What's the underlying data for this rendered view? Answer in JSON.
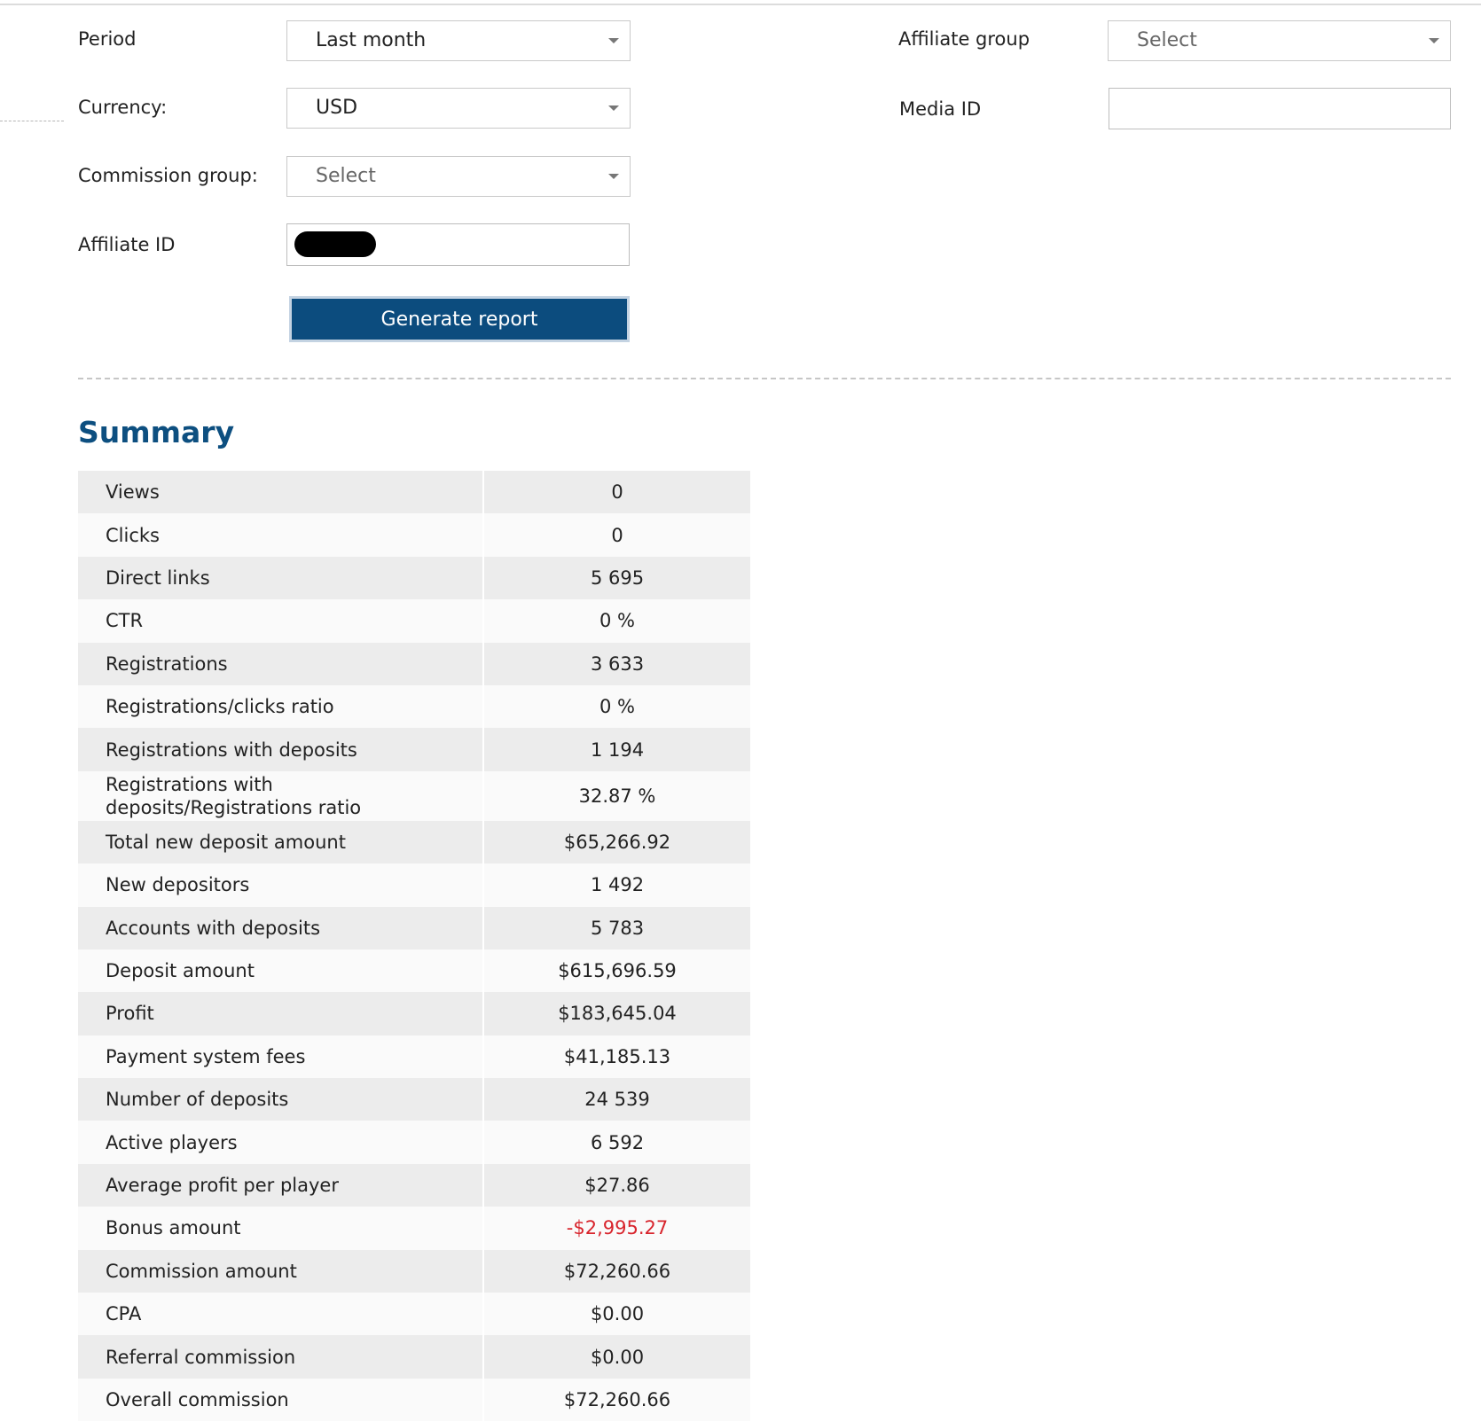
{
  "filters": {
    "period": {
      "label": "Period",
      "value": "Last month"
    },
    "currency": {
      "label": "Currency:",
      "value": "USD"
    },
    "commission_group": {
      "label": "Commission group:",
      "placeholder": "Select"
    },
    "affiliate_id": {
      "label": "Affiliate ID"
    },
    "affiliate_group": {
      "label": "Affiliate group",
      "placeholder": "Select"
    },
    "media_id": {
      "label": "Media ID"
    },
    "generate_button": "Generate report"
  },
  "summary": {
    "title": "Summary",
    "negative_color": "#d8242c",
    "rows": [
      {
        "label": "Views",
        "value": "0"
      },
      {
        "label": "Clicks",
        "value": "0"
      },
      {
        "label": "Direct links",
        "value": "5 695"
      },
      {
        "label": "CTR",
        "value": "0 %"
      },
      {
        "label": "Registrations",
        "value": "3 633"
      },
      {
        "label": "Registrations/clicks ratio",
        "value": "0 %"
      },
      {
        "label": "Registrations with deposits",
        "value": "1 194"
      },
      {
        "label": "Registrations with deposits/Registrations ratio",
        "value": "32.87 %"
      },
      {
        "label": "Total new deposit amount",
        "value": "$65,266.92"
      },
      {
        "label": "New depositors",
        "value": "1 492"
      },
      {
        "label": "Accounts with deposits",
        "value": "5 783"
      },
      {
        "label": "Deposit amount",
        "value": "$615,696.59"
      },
      {
        "label": "Profit",
        "value": "$183,645.04"
      },
      {
        "label": "Payment system fees",
        "value": "$41,185.13"
      },
      {
        "label": "Number of deposits",
        "value": "24 539"
      },
      {
        "label": "Active players",
        "value": "6 592"
      },
      {
        "label": "Average profit per player",
        "value": "$27.86"
      },
      {
        "label": "Bonus amount",
        "value": "-$2,995.27"
      },
      {
        "label": "Commission amount",
        "value": "$72,260.66"
      },
      {
        "label": "CPA",
        "value": "$0.00"
      },
      {
        "label": "Referral commission",
        "value": "$0.00"
      },
      {
        "label": "Overall commission",
        "value": "$72,260.66"
      }
    ]
  }
}
